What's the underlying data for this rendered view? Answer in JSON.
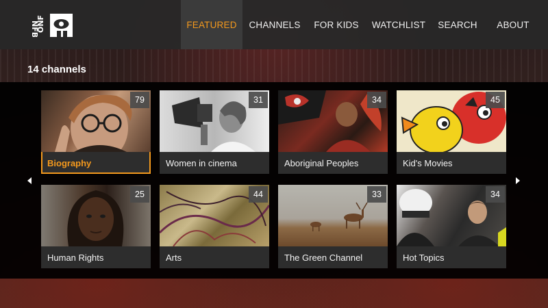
{
  "nav": {
    "items": [
      {
        "label": "FEATURED",
        "active": true
      },
      {
        "label": "CHANNELS",
        "active": false
      },
      {
        "label": "FOR KIDS",
        "active": false
      },
      {
        "label": "WATCHLIST",
        "active": false
      },
      {
        "label": "SEARCH",
        "active": false
      },
      {
        "label": "ABOUT",
        "active": false
      }
    ]
  },
  "logo": {
    "text_left": "ONF",
    "text_right": "NFB",
    "icon": "eye-figure-icon"
  },
  "channels_count": "14 channels",
  "channels": [
    {
      "label": "Biography",
      "count": "79",
      "selected": true
    },
    {
      "label": "Women in cinema",
      "count": "31",
      "selected": false
    },
    {
      "label": "Aboriginal Peoples",
      "count": "34",
      "selected": false
    },
    {
      "label": "Kid's Movies",
      "count": "45",
      "selected": false
    },
    {
      "label": "Human Rights",
      "count": "25",
      "selected": false
    },
    {
      "label": "Arts",
      "count": "44",
      "selected": false
    },
    {
      "label": "The Green Channel",
      "count": "33",
      "selected": false
    },
    {
      "label": "Hot Topics",
      "count": "34",
      "selected": false
    }
  ],
  "colors": {
    "accent": "#f59a1d",
    "bar": "#282828",
    "tile": "#2d2d2d"
  },
  "icons": {
    "prev": "chevron-left-icon",
    "next": "chevron-right-icon"
  }
}
